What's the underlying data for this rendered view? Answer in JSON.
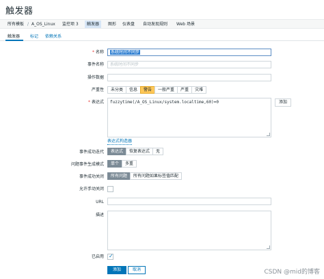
{
  "page": {
    "title": "触发器"
  },
  "breadcrumb": {
    "items": [
      "所有模板",
      "A_OS_Linux",
      "监控项 3",
      "触发器",
      "图形",
      "仪表盘",
      "自动发现规则",
      "Web 场景"
    ],
    "separator": "/"
  },
  "tabs": [
    "触发器",
    "标记",
    "依赖关系"
  ],
  "form": {
    "name": {
      "label": "名称",
      "value": "系统时间不同步"
    },
    "event_name": {
      "label": "事件名称",
      "placeholder": "系统时间不同步"
    },
    "opdata": {
      "label": "操作数据"
    },
    "severity": {
      "label": "严重性",
      "options": [
        "未分类",
        "信息",
        "警告",
        "一般严重",
        "严重",
        "灾难"
      ],
      "selected": "警告"
    },
    "expression": {
      "label": "表达式",
      "value": "fuzzytime(/A_OS_Linux/system.localtime,60)=0",
      "add_button": "添加",
      "builder_link": "表达式构造器"
    },
    "ok_event_generation": {
      "label": "事件成功迭代",
      "options": [
        "表达式",
        "恢复表达式",
        "无"
      ],
      "selected": "表达式"
    },
    "problem_mode": {
      "label": "问题事件生成模式",
      "options": [
        "单个",
        "多重"
      ],
      "selected": "单个"
    },
    "ok_close": {
      "label": "事件成功关闭",
      "options": [
        "所有问题",
        "所有问题如果标签值匹配"
      ],
      "selected": "所有问题"
    },
    "manual_close": {
      "label": "允许手动关闭",
      "checked": false
    },
    "url": {
      "label": "URL",
      "value": ""
    },
    "description": {
      "label": "描述",
      "value": ""
    },
    "enabled": {
      "label": "已启用",
      "checked": true
    }
  },
  "actions": {
    "add": "添加",
    "cancel": "取消"
  },
  "watermark": "CSDN @mid的博客",
  "colors": {
    "accent": "#0275b8",
    "warning": "#ffc859",
    "selected_segment": "#7c8b96",
    "required": "#e33734"
  }
}
